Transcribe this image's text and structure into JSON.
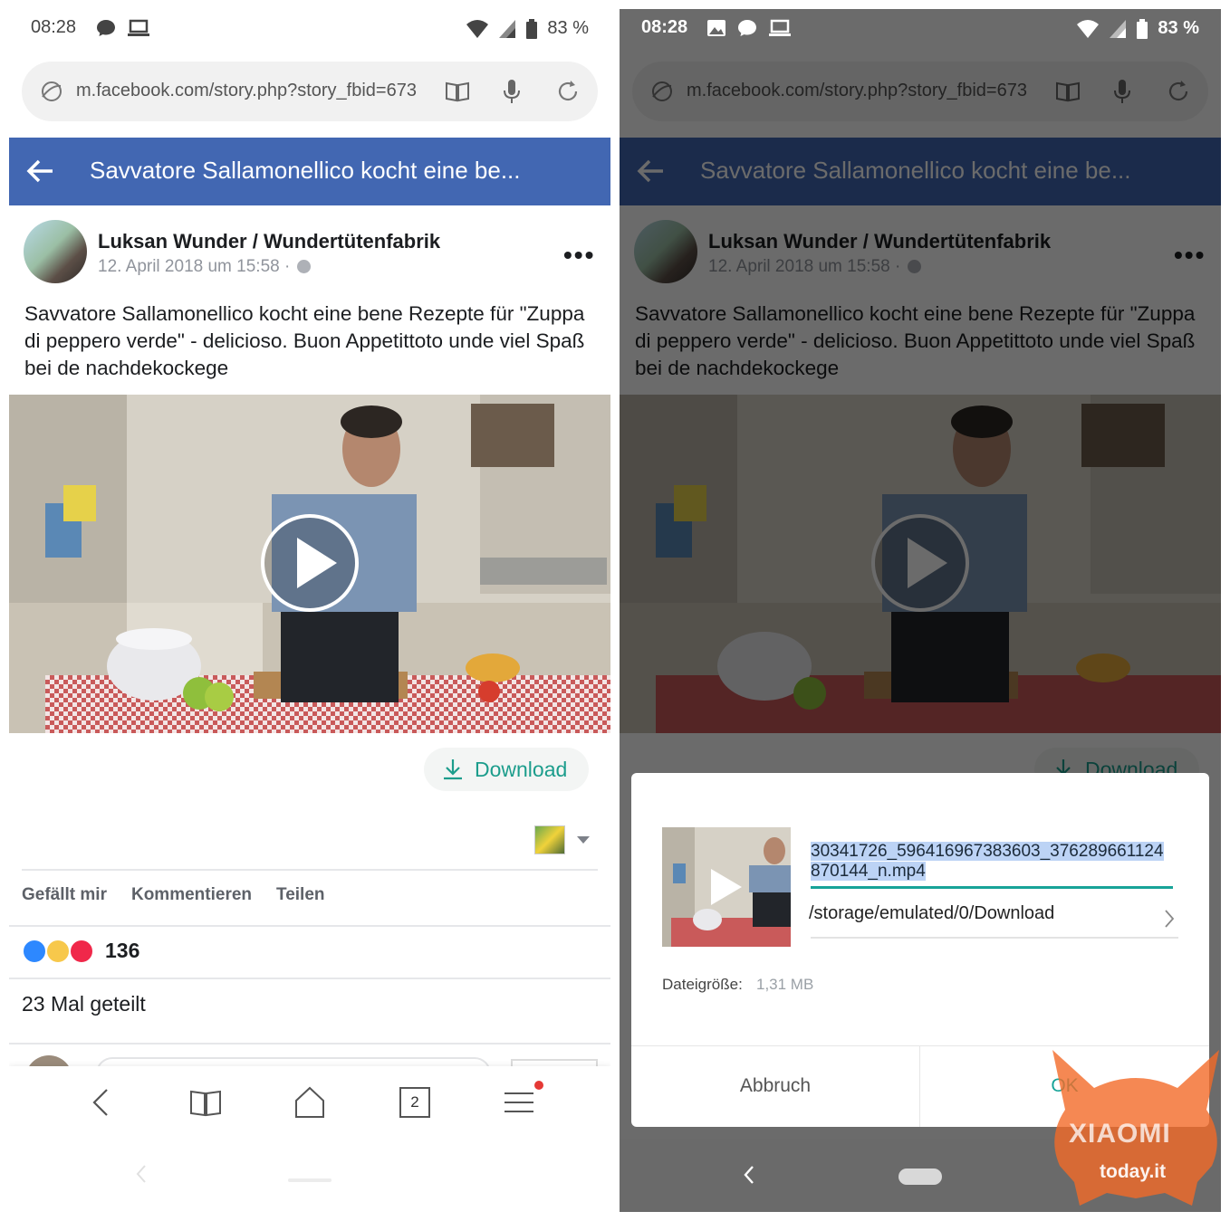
{
  "status_bar": {
    "time": "08:28",
    "battery": "83 %"
  },
  "browser": {
    "url": "m.facebook.com/story.php?story_fbid=673",
    "tab_count": "2"
  },
  "fb_header": {
    "title": "Savvatore Sallamonellico kocht eine be..."
  },
  "post": {
    "author": "Luksan Wunder / Wundertütenfabrik",
    "date": "12. April 2018 um 15:58 ·",
    "more": "•••",
    "text": "Savvatore Sallamonellico kocht eine bene Rezepte für \"Zuppa di peppero verde\" - delicioso. Buon Appetittoto unde viel Spaß bei de nachdekockege"
  },
  "download_chip": {
    "label": "Download"
  },
  "actions": {
    "like": "Gefällt mir",
    "comment": "Kommentieren",
    "share": "Teilen"
  },
  "reactions": {
    "count": "136"
  },
  "shares": "23 Mal geteilt",
  "dialog": {
    "filename": "30341726_596416967383603_376289661124870144_n.mp4",
    "path": "/storage/emulated/0/Download",
    "size_label": "Dateigröße:",
    "size_value": "1,31 MB",
    "cancel": "Abbruch",
    "ok": "OK"
  },
  "watermark": {
    "line1": "XIAOMI",
    "line2": "today.it"
  },
  "colors": {
    "fb_blue": "#4267b2",
    "accent_teal": "#17a398",
    "download_green": "#1c9d8c",
    "like_blue": "#2d88ff",
    "love_red": "#f0284a",
    "haha_yellow": "#f7c84b",
    "xiaomi_orange": "#f26a28"
  },
  "icons": [
    "chat-icon",
    "laptop-icon",
    "image-icon",
    "wifi-icon",
    "signal-icon",
    "battery-icon",
    "globe-icon",
    "reader-icon",
    "mic-icon",
    "reload-icon",
    "back-arrow-icon",
    "play-icon",
    "download-icon",
    "chevron-right-icon",
    "home-icon",
    "bookmarks-icon",
    "menu-icon"
  ]
}
